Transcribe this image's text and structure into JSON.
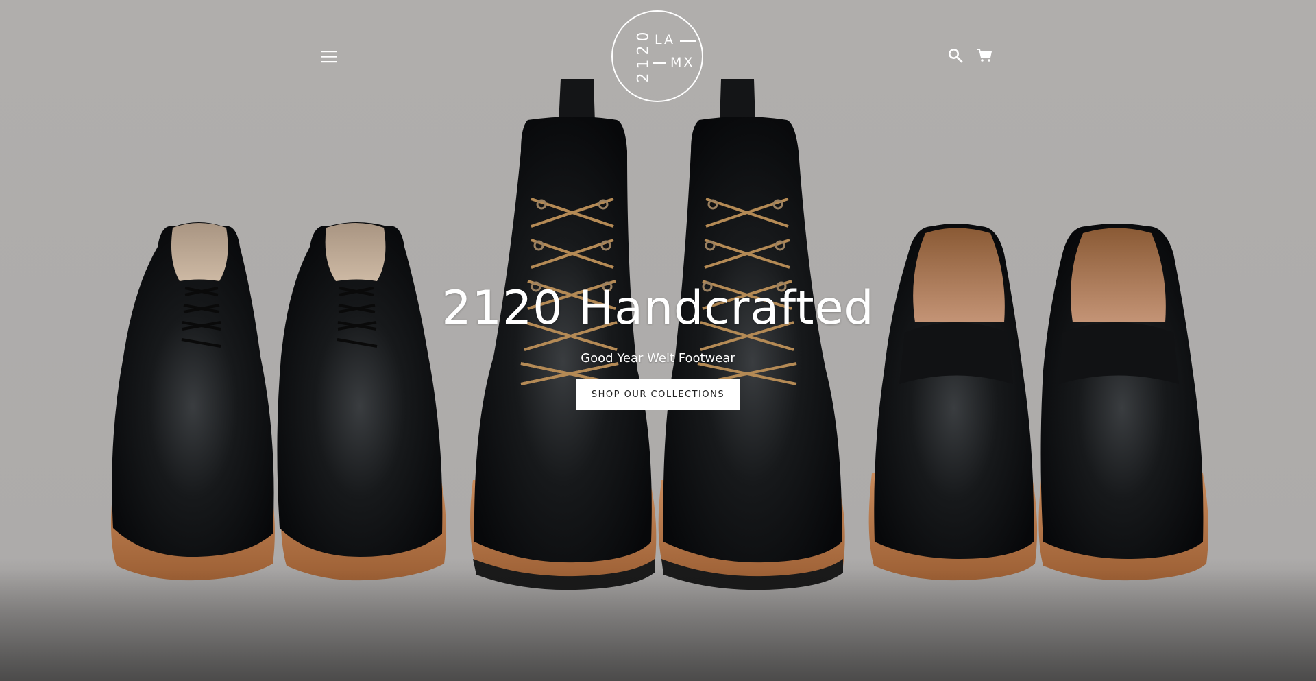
{
  "brand": {
    "logo_vertical": "2120",
    "logo_la": "LA",
    "logo_mx": "MX"
  },
  "header": {
    "menu_icon": "hamburger-icon",
    "search_icon": "search-icon",
    "cart_icon": "cart-icon"
  },
  "hero": {
    "title": "2120 Handcrafted",
    "subtitle": "Good Year Welt Footwear",
    "cta_label": "SHOP OUR COLLECTIONS"
  },
  "colors": {
    "background": "#b0aeac",
    "text": "#ffffff",
    "button_bg": "#ffffff",
    "button_text": "#222222",
    "leather": "#111214",
    "sole": "#b9774a",
    "laces": "#b48a55"
  }
}
